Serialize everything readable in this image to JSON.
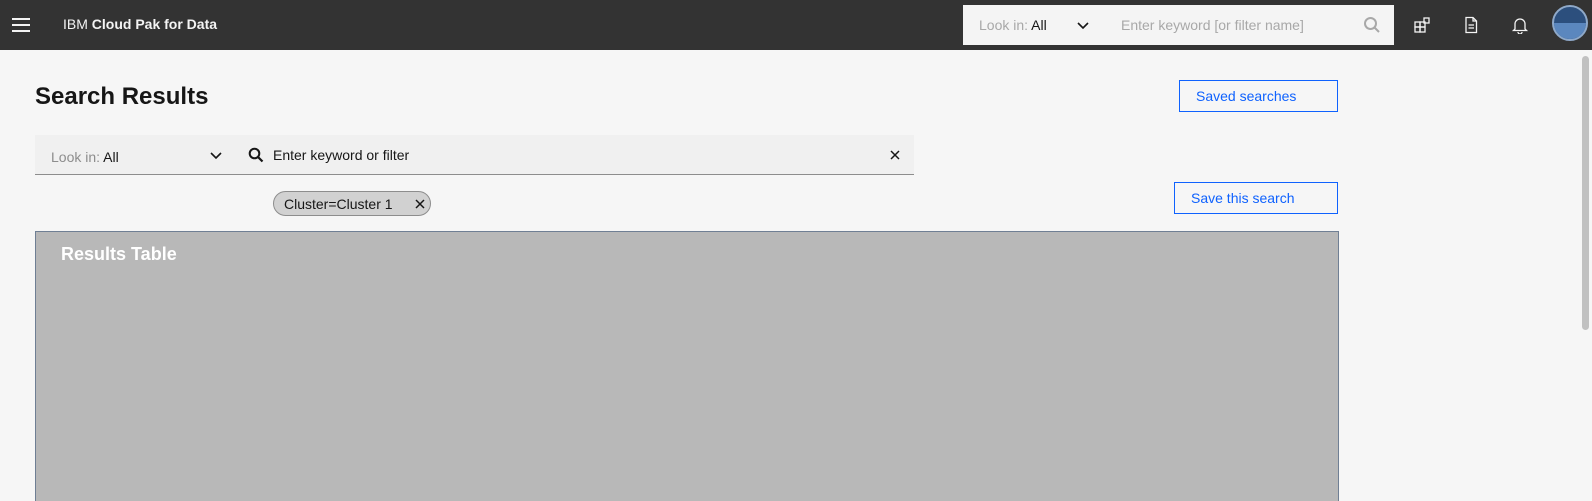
{
  "header": {
    "brand_prefix": "IBM",
    "brand_name": "Cloud Pak for Data",
    "search": {
      "look_in_label": "Look in:",
      "look_in_value": "All",
      "placeholder": "Enter keyword [or filter name]"
    },
    "icons": [
      "menu-icon",
      "apps-icon",
      "document-icon",
      "notification-icon",
      "user-avatar"
    ]
  },
  "page": {
    "title": "Search Results",
    "saved_searches_label": "Saved searches",
    "save_search_label": "Save this search",
    "search": {
      "look_in_label": "Look in:",
      "look_in_value": "All",
      "placeholder": "Enter keyword or filter"
    },
    "filter_tag": "Cluster=Cluster 1",
    "results_title": "Results Table"
  },
  "colors": {
    "header_bg": "#333333",
    "accent": "#0f62fe",
    "results_bg": "#b8b8b8"
  }
}
